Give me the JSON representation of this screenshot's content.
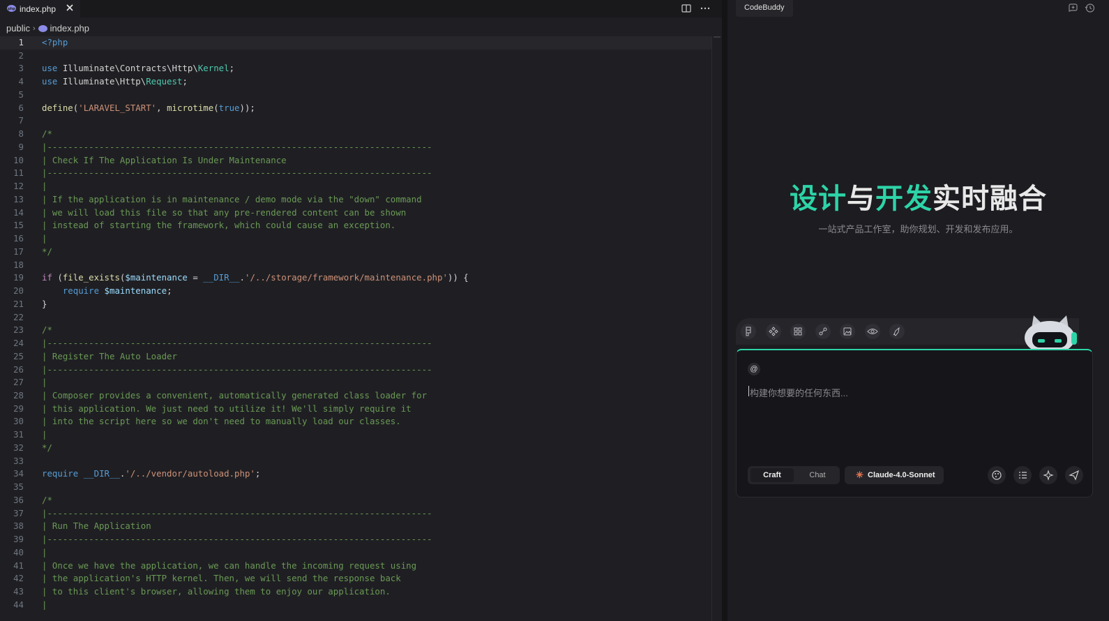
{
  "editor": {
    "tab": {
      "label": "index.php",
      "close_icon": "close-icon",
      "file_icon": "php-icon"
    },
    "tab_actions": [
      "split-editor-icon",
      "more-actions-icon"
    ],
    "breadcrumb": {
      "folder": "public",
      "separator": "›",
      "file": "index.php"
    },
    "active_line": 1,
    "lines": [
      "<?php",
      "",
      "use Illuminate\\Contracts\\Http\\Kernel;",
      "use Illuminate\\Http\\Request;",
      "",
      "define('LARAVEL_START', microtime(true));",
      "",
      "/*",
      "|--------------------------------------------------------------------------",
      "| Check If The Application Is Under Maintenance",
      "|--------------------------------------------------------------------------",
      "|",
      "| If the application is in maintenance / demo mode via the \"down\" command",
      "| we will load this file so that any pre-rendered content can be shown",
      "| instead of starting the framework, which could cause an exception.",
      "|",
      "*/",
      "",
      "if (file_exists($maintenance = __DIR__.'/../storage/framework/maintenance.php')) {",
      "    require $maintenance;",
      "}",
      "",
      "/*",
      "|--------------------------------------------------------------------------",
      "| Register The Auto Loader",
      "|--------------------------------------------------------------------------",
      "|",
      "| Composer provides a convenient, automatically generated class loader for",
      "| this application. We just need to utilize it! We'll simply require it",
      "| into the script here so we don't need to manually load our classes.",
      "|",
      "*/",
      "",
      "require __DIR__.'/../vendor/autoload.php';",
      "",
      "/*",
      "|--------------------------------------------------------------------------",
      "| Run The Application",
      "|--------------------------------------------------------------------------",
      "|",
      "| Once we have the application, we can handle the incoming request using",
      "| the application's HTTP kernel. Then, we will send the response back",
      "| to this client's browser, allowing them to enjoy our application.",
      "|"
    ]
  },
  "panel": {
    "header_tab": "CodeBuddy",
    "header_icons": [
      "new-chat-icon",
      "history-icon"
    ],
    "hero": {
      "title_green_1": "设计",
      "title_white_1": "与",
      "title_green_2": "开发",
      "title_white_2": "实时融合",
      "subtitle": "一站式产品工作室，助你规划、开发和发布应用。"
    },
    "tools": [
      "figma-icon",
      "component-icon",
      "grid-icon",
      "link-icon",
      "image-icon",
      "preview-icon",
      "deploy-icon"
    ],
    "input": {
      "at_symbol": "@",
      "placeholder": "构建你想要的任何东西..."
    },
    "modes": {
      "craft": "Craft",
      "chat": "Chat",
      "selected": "Craft"
    },
    "model": "Claude-4.0-Sonnet",
    "actions": [
      "palette-icon",
      "list-icon",
      "enhance-icon",
      "send-icon"
    ]
  },
  "colors": {
    "accent": "#2dd4a7",
    "editor_bg": "#1f1f23",
    "comment": "#6a9955",
    "keyword": "#569cd6",
    "string": "#ce9178",
    "class": "#4ec9b0"
  }
}
